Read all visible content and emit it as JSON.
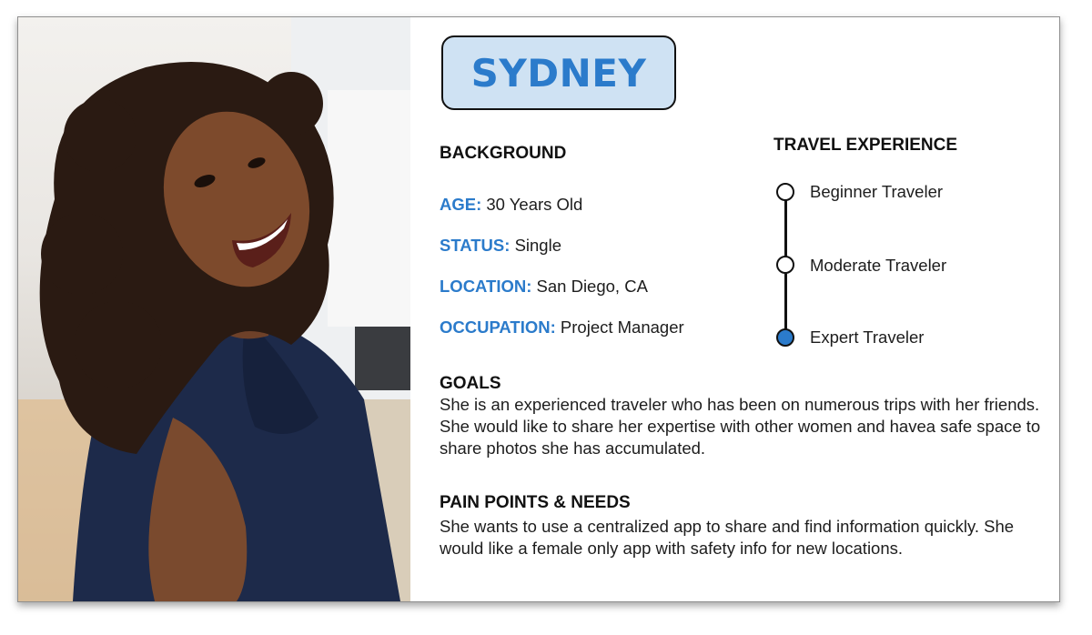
{
  "persona": {
    "name": "SYDNEY"
  },
  "background": {
    "heading": "BACKGROUND",
    "fields": [
      {
        "key": "AGE:",
        "value": "30 Years Old"
      },
      {
        "key": "STATUS:",
        "value": "Single"
      },
      {
        "key": "LOCATION:",
        "value": "San Diego, CA"
      },
      {
        "key": "OCCUPATION:",
        "value": "Project Manager"
      }
    ]
  },
  "travel_experience": {
    "heading": "TRAVEL EXPERIENCE",
    "levels": [
      {
        "label": "Beginner Traveler",
        "selected": false
      },
      {
        "label": "Moderate Traveler",
        "selected": false
      },
      {
        "label": "Expert Traveler",
        "selected": true
      }
    ]
  },
  "goals": {
    "heading": "GOALS",
    "text": "She is an experienced traveler who has been on numerous trips with her friends. She would like to share her expertise with other women and havea safe space to share photos she has accumulated."
  },
  "pain_points": {
    "heading": "PAIN POINTS & NEEDS",
    "text": "She wants to use a centralized app to share and find information quickly. She would like a female only app with safety info for new locations."
  },
  "colors": {
    "accent": "#2b7bcb",
    "badge_fill": "#cfe2f3",
    "text": "#1d1d1d"
  }
}
